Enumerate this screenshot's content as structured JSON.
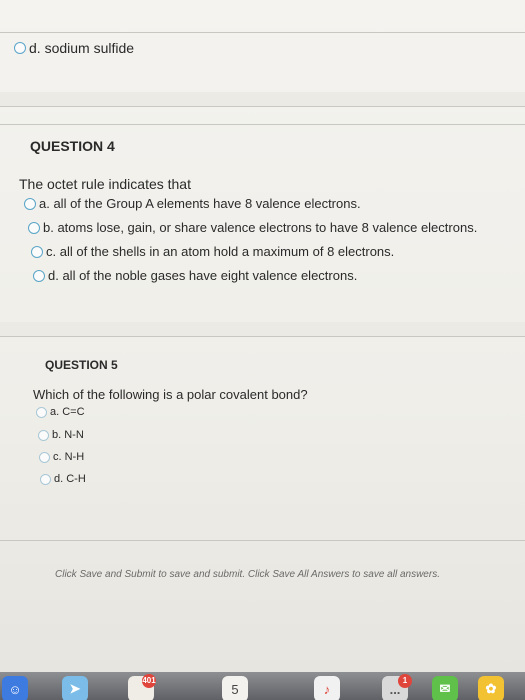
{
  "prev_question": {
    "option_d": "d. sodium sulfide"
  },
  "question4": {
    "title": "QUESTION 4",
    "prompt": "The octet rule indicates that",
    "options": [
      "a. all of the Group A elements have 8 valence electrons.",
      "b. atoms lose, gain, or share valence electrons to have 8 valence electrons.",
      "c. all of the shells in an atom hold a maximum of 8 electrons.",
      "d. all of the noble gases have eight valence electrons."
    ]
  },
  "question5": {
    "title": "QUESTION 5",
    "prompt": "Which of the following is a polar covalent bond?",
    "options": [
      "a. C=C",
      "b. N-N",
      "c. N-H",
      "d. C-H"
    ]
  },
  "footer": {
    "instruction": "Click Save and Submit to save and submit. Click Save All Answers to save all answers."
  },
  "dock": {
    "badge_calendar": "401",
    "calendar_day": "5",
    "badge_notification": "1",
    "more": "..."
  }
}
